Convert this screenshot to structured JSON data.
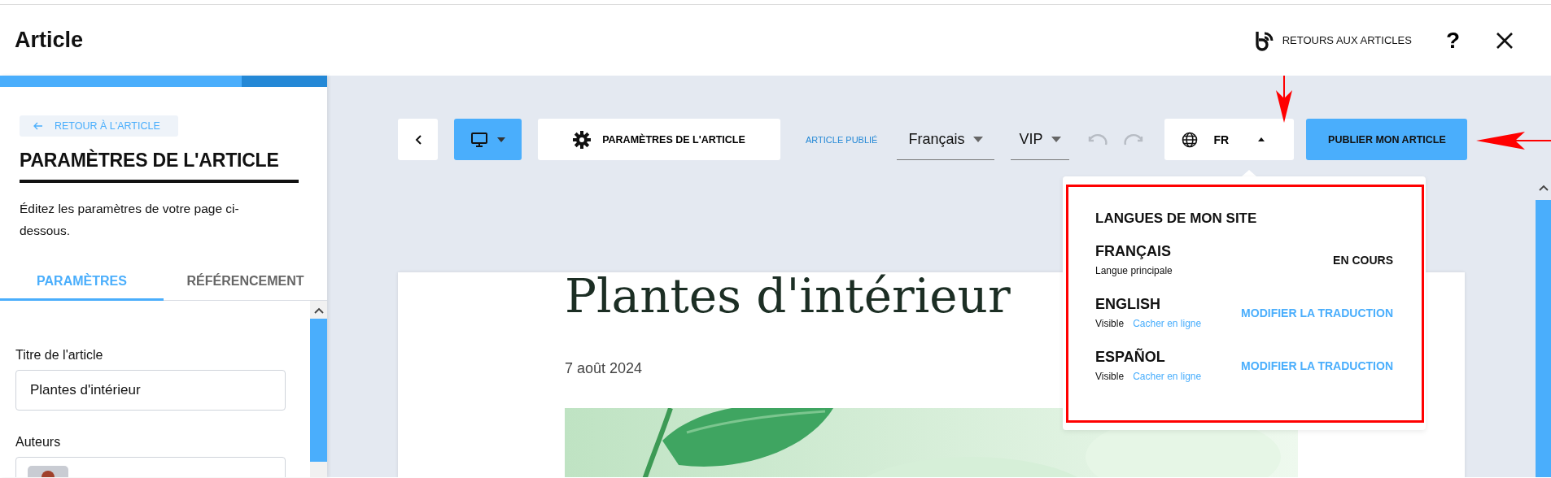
{
  "header": {
    "title": "Article",
    "back_link": "RETOURS AUX ARTICLES",
    "help": "?"
  },
  "sidebar": {
    "progress": {
      "level": 0.74
    },
    "back_button": "RETOUR À L'ARTICLE",
    "heading": "PARAMÈTRES DE L'ARTICLE",
    "description": "Éditez les paramètres de votre page ci-dessous.",
    "tabs": [
      {
        "label": "PARAMÈTRES",
        "selected": true
      },
      {
        "label": "RÉFÉRENCEMENT",
        "selected": false
      }
    ],
    "fields": [
      {
        "label": "Titre de l'article",
        "kind": "text",
        "value": "Plantes d'intérieur"
      },
      {
        "label": "Auteurs",
        "kind": "authors"
      }
    ]
  },
  "toolbar": {
    "settings_button": "PARAMÈTRES DE L'ARTICLE",
    "status": "ARTICLE PUBLIÉ",
    "selects": [
      {
        "value": "Français"
      },
      {
        "value": "VIP"
      }
    ],
    "undo": {
      "disabled": true
    },
    "redo": {
      "disabled": true
    },
    "language": {
      "code": "FR",
      "expanded": true
    },
    "publish_button": "PUBLIER MON ARTICLE"
  },
  "language_menu": {
    "title": "LANGUES DE MON SITE",
    "languages": [
      {
        "name": "FRANÇAIS",
        "kind": "main",
        "note": "Langue principale",
        "status": "EN COURS"
      },
      {
        "name": "ENGLISH",
        "kind": "translation",
        "visibility": "Visible",
        "toggle": "Cacher en ligne",
        "action": "MODIFIER LA TRADUCTION"
      },
      {
        "name": "ESPAÑOL",
        "kind": "translation",
        "visibility": "Visible",
        "toggle": "Cacher en ligne",
        "action": "MODIFIER LA TRADUCTION"
      }
    ]
  },
  "article": {
    "title": "Plantes d'intérieur",
    "date": "7 août 2024"
  }
}
